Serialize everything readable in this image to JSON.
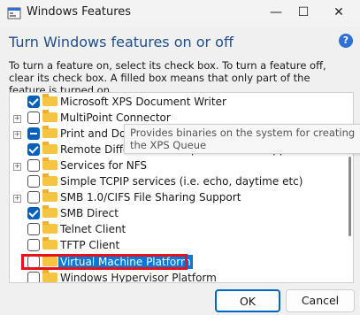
{
  "window": {
    "title": "Windows Features",
    "minimize_glyph": "—",
    "maximize_glyph": "☐",
    "close_glyph": "✕"
  },
  "header": {
    "heading": "Turn Windows features on or off",
    "help_glyph": "?",
    "description": "To turn a feature on, select its check box. To turn a feature off, clear its check box. A filled box means that only part of the feature is turned on."
  },
  "features": [
    {
      "label": "Microsoft XPS Document Writer",
      "state": "checked",
      "expandable": false
    },
    {
      "label": "MultiPoint Connector",
      "state": "unchecked",
      "expandable": true
    },
    {
      "label": "Print and Document Services",
      "state": "partial",
      "expandable": true
    },
    {
      "label": "Remote Differential Compression API Support",
      "state": "checked",
      "expandable": false
    },
    {
      "label": "Services for NFS",
      "state": "unchecked",
      "expandable": true
    },
    {
      "label": "Simple TCPIP services (i.e. echo, daytime etc)",
      "state": "unchecked",
      "expandable": false
    },
    {
      "label": "SMB 1.0/CIFS File Sharing Support",
      "state": "unchecked",
      "expandable": true
    },
    {
      "label": "SMB Direct",
      "state": "checked",
      "expandable": false
    },
    {
      "label": "Telnet Client",
      "state": "unchecked",
      "expandable": false
    },
    {
      "label": "TFTP Client",
      "state": "unchecked",
      "expandable": false
    },
    {
      "label": "Virtual Machine Platform",
      "state": "unchecked",
      "expandable": false,
      "selected": true
    },
    {
      "label": "Windows Hypervisor Platform",
      "state": "unchecked",
      "expandable": false
    }
  ],
  "tooltip": {
    "text": "Provides binaries on the system for creating the XPS Queue"
  },
  "buttons": {
    "ok": "OK",
    "cancel": "Cancel"
  },
  "colors": {
    "accent": "#005fb8",
    "highlight_box": "#e8101c",
    "heading": "#1f4e8c"
  }
}
